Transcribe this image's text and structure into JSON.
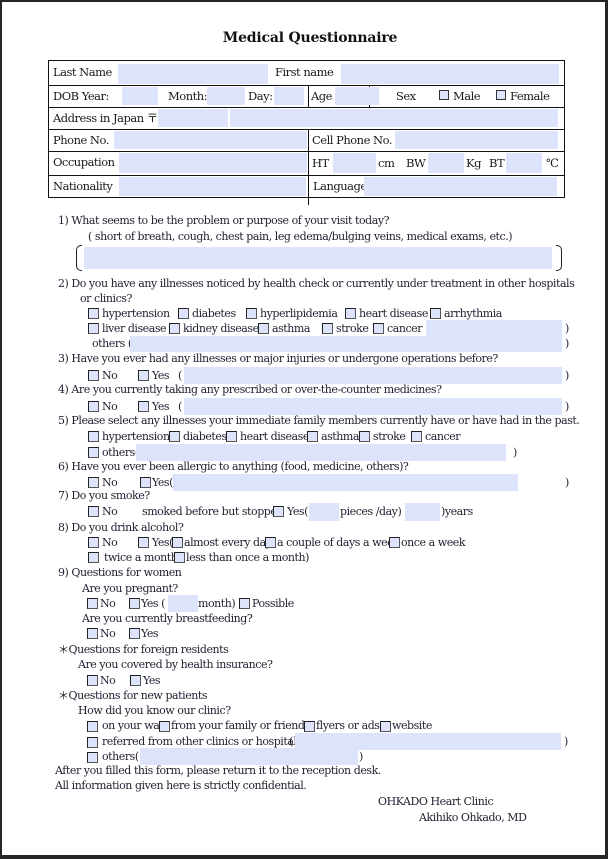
{
  "title": "Medical Questionnaire",
  "header_table": {
    "last_name_label": "Last Name",
    "first_name_label": "First name",
    "dob_year_label": "DOB Year:",
    "month_label": "Month:",
    "day_label": "Day:",
    "age_label": "Age",
    "sex_label": "Sex",
    "male_label": "Male",
    "female_label": "Female",
    "address_label": "Address in Japan 〒",
    "phone_label": "Phone No.",
    "cell_phone_label": "Cell Phone No.",
    "occupation_label": "Occupation",
    "ht_label": "HT",
    "cm_label": "cm",
    "bw_label": "BW",
    "kg_label": "Kg",
    "bt_label": "BT",
    "celsius_label": "℃",
    "nationality_label": "Nationality",
    "language_label": "Language"
  },
  "fields": {
    "last_name": "",
    "first_name": "",
    "dob_year": "",
    "dob_month": "",
    "dob_day": "",
    "age": "",
    "postal_code": "",
    "address": "",
    "phone": "",
    "cell_phone": "",
    "occupation": "",
    "height": "",
    "weight": "",
    "temperature": "",
    "nationality": "",
    "language": ""
  },
  "q1": {
    "question": "1) What seems to be the problem or purpose of your visit today?",
    "hint": "( short of breath, cough, chest pain, leg edema/bulging veins, medical exams, etc.)",
    "answer": ""
  },
  "q2": {
    "question_line1": "2) Do you have any illnesses noticed by health check or currently under treatment in other hospitals",
    "question_line2": "or clinics?",
    "options": [
      "hypertension",
      "diabetes",
      "hyperlipidemia",
      "heart disease",
      "arrhythmia",
      "liver disease",
      "kidney disease",
      "asthma",
      "stroke",
      "cancer ("
    ],
    "others_label": "others (",
    "close_paren": ")"
  },
  "q3": {
    "question": "3) Have you ever had any illnesses or major injuries or undergone operations before?",
    "no": "No",
    "yes": "Yes",
    "open_paren": "(",
    "close_paren": ")"
  },
  "q4": {
    "question": "4) Are you currently taking any prescribed or over-the-counter medicines?",
    "no": "No",
    "yes": "Yes",
    "open_paren": "(",
    "close_paren": ")"
  },
  "q5": {
    "question": "5) Please select any illnesses your immediate family members currently have or have had in the past.",
    "options": [
      "hypertension",
      "diabetes",
      "heart disease",
      "asthma",
      "stroke",
      "cancer"
    ],
    "others_label": "others(",
    "close_paren": ")"
  },
  "q6": {
    "question": "6) Have you ever been allergic to anything (food, medicine, others)?",
    "no": "No",
    "yes": "Yes(",
    "close_paren": ")"
  },
  "q7": {
    "question": "7) Do you smoke?",
    "no": "No",
    "stopped": "smoked before but stopped",
    "yes": "Yes(",
    "pieces": "pieces /day) (",
    "years": ")years"
  },
  "q8": {
    "question": "8) Do you drink alcohol?",
    "no": "No",
    "yes": "Yes(",
    "options": [
      "almost every day",
      "a couple of days a week",
      "once a week",
      "twice a month",
      "less than once a month)"
    ]
  },
  "q9": {
    "heading": "9) Questions for women",
    "pregnant_q": "Are you pregnant?",
    "no": "No",
    "yes": "Yes (",
    "month": "month)",
    "possible": "Possible",
    "breastfeeding_q": "Are you currently breastfeeding?",
    "bf_no": "No",
    "bf_yes": "Yes"
  },
  "foreign": {
    "heading": "＊Questions for foreign residents",
    "insurance_q": "Are you covered by health insurance?",
    "no": "No",
    "yes": "Yes"
  },
  "new_patients": {
    "heading": "＊Questions for new patients",
    "question": "How did you know our clinic?",
    "options": [
      "on your way",
      "from your family or friends",
      "flyers or ads",
      "website"
    ],
    "referred": "referred from other clinics or hospitals",
    "open_paren": "(",
    "close_paren": ")",
    "others": "others(",
    "others_close": ")"
  },
  "footer": {
    "line1": "After you filled this form, please return it to the reception desk.",
    "line2": "All information given here is strictly confidential.",
    "clinic": "OHKADO Heart Clinic",
    "doctor": "Akihiko Ohkado, MD"
  }
}
